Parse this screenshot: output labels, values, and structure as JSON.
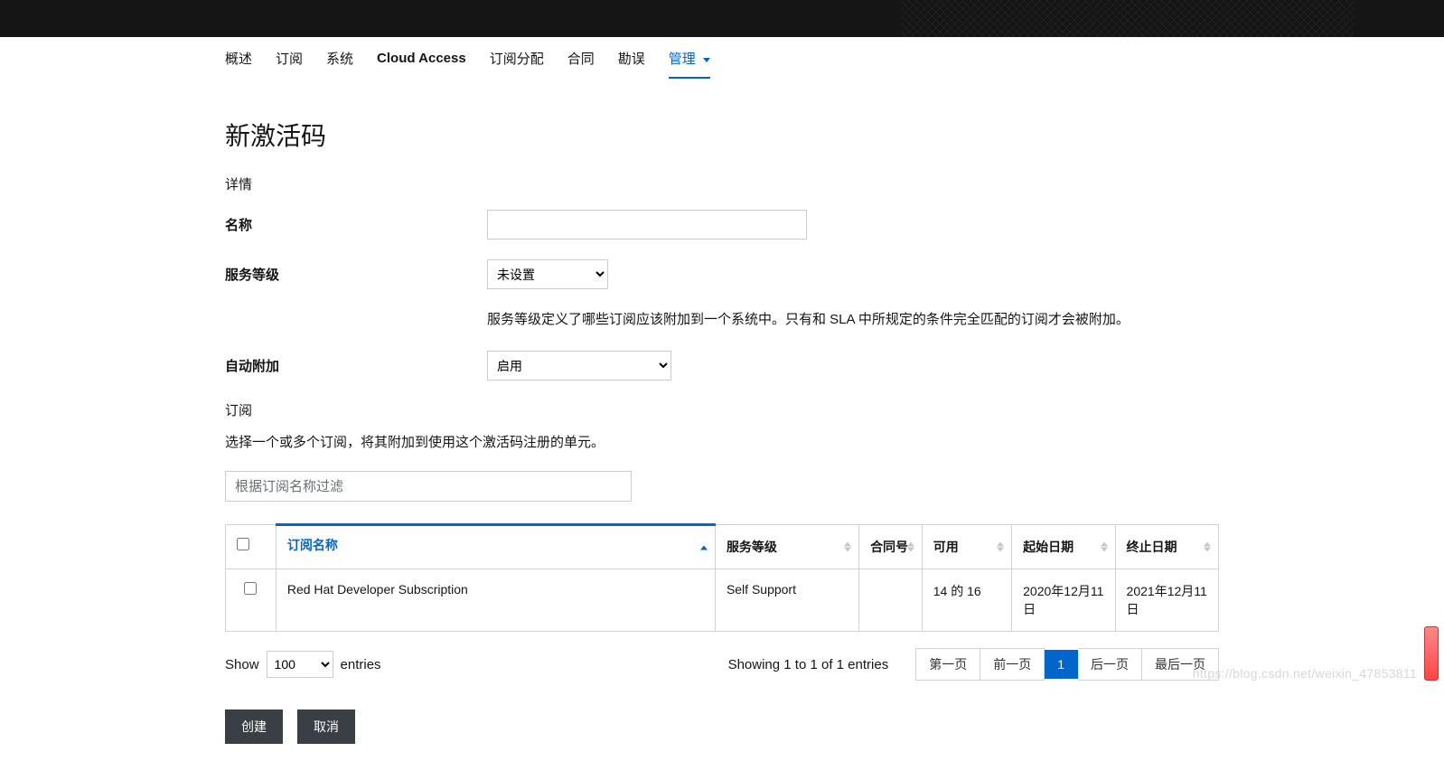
{
  "nav": {
    "items": [
      {
        "label": "概述"
      },
      {
        "label": "订阅"
      },
      {
        "label": "系统"
      },
      {
        "label": "Cloud Access",
        "strong": true
      },
      {
        "label": "订阅分配"
      },
      {
        "label": "合同"
      },
      {
        "label": "勘误"
      },
      {
        "label": "管理",
        "active": true
      }
    ]
  },
  "page": {
    "title": "新激活码",
    "details_label": "详情"
  },
  "form": {
    "name": {
      "label": "名称",
      "value": ""
    },
    "service_level": {
      "label": "服务等级",
      "selected": "未设置",
      "help": "服务等级定义了哪些订阅应该附加到一个系统中。只有和 SLA 中所规定的条件完全匹配的订阅才会被附加。"
    },
    "auto_attach": {
      "label": "自动附加",
      "selected": "启用"
    }
  },
  "subscriptions": {
    "heading": "订阅",
    "description": "选择一个或多个订阅，将其附加到使用这个激活码注册的单元。",
    "filter_placeholder": "根据订阅名称过滤",
    "columns": {
      "sub_name": "订阅名称",
      "service_level": "服务等级",
      "contract": "合同号",
      "available": "可用",
      "start_date": "起始日期",
      "end_date": "终止日期"
    },
    "rows": [
      {
        "name": "Red Hat Developer Subscription",
        "service_level": "Self Support",
        "contract": "",
        "available": "14 的 16",
        "start_date": "2020年12月11日",
        "end_date": "2021年12月11日"
      }
    ]
  },
  "table_footer": {
    "show_label": "Show",
    "entries_label": "entries",
    "page_size": "100",
    "info": "Showing 1 to 1 of 1 entries",
    "pager": {
      "first": "第一页",
      "prev": "前一页",
      "current": "1",
      "next": "后一页",
      "last": "最后一页"
    }
  },
  "actions": {
    "create": "创建",
    "cancel": "取消"
  },
  "watermark": "https://blog.csdn.net/weixin_47853811"
}
